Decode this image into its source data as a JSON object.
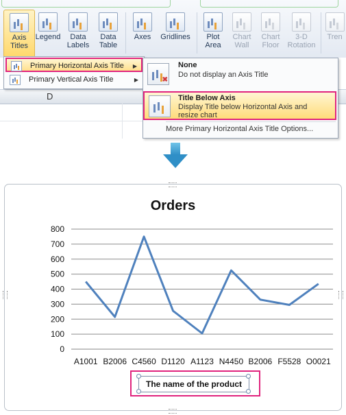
{
  "ribbon": {
    "buttons": {
      "axis_titles": "Axis\nTitles",
      "legend": "Legend",
      "data_labels": "Data\nLabels",
      "data_table": "Data\nTable",
      "axes": "Axes",
      "gridlines": "Gridlines",
      "plot_area": "Plot\nArea",
      "chart_wall": "Chart\nWall",
      "chart_floor": "Chart\nFloor",
      "rotation": "3-D\nRotation",
      "trendline": "Tren"
    }
  },
  "submenu": {
    "items": [
      {
        "label": "Primary Horizontal Axis Title",
        "highlighted": true
      },
      {
        "label": "Primary Vertical Axis Title",
        "highlighted": false
      }
    ]
  },
  "sheet": {
    "column": "D"
  },
  "dropdown": {
    "none_title": "None",
    "none_desc": "Do not display an Axis Title",
    "below_title": "Title Below Axis",
    "below_desc1": "Display Title below Horizontal Axis and",
    "below_desc2": "resize chart",
    "more": "More Primary Horizontal Axis Title Options..."
  },
  "chart": {
    "x_axis_title": "The name of the product"
  },
  "chart_data": {
    "type": "line",
    "title": "Orders",
    "xlabel": "The name of the product",
    "ylabel": "",
    "categories": [
      "A1001",
      "B2006",
      "C4560",
      "D1120",
      "A1123",
      "N4450",
      "B2006",
      "F5528",
      "O0021"
    ],
    "series": [
      {
        "values": [
          450,
          215,
          750,
          255,
          105,
          525,
          330,
          295,
          435
        ],
        "color": "#4f81bd"
      }
    ],
    "yticks": [
      "0",
      "100",
      "200",
      "300",
      "400",
      "500",
      "600",
      "700",
      "800"
    ],
    "ylim": [
      0,
      800
    ],
    "grid": true,
    "legend": "none"
  },
  "colors": {
    "highlight_border": "#e0237d",
    "series_line": "#4f81bd",
    "arrow": "#2f8fc7"
  }
}
